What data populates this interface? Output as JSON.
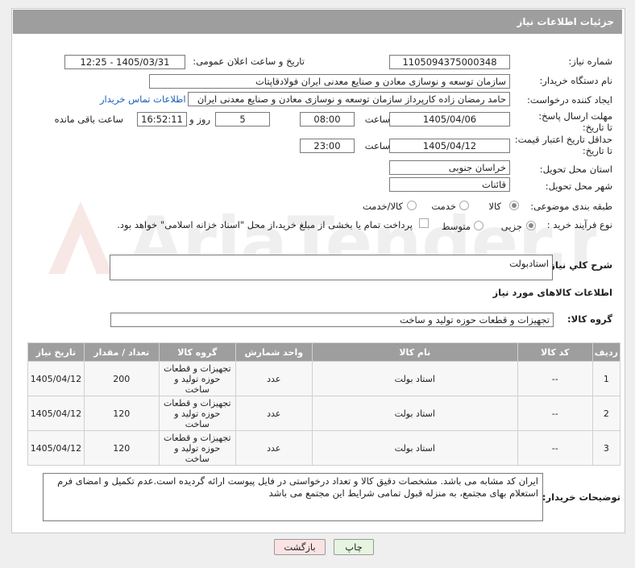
{
  "header": {
    "title": "جزئیات اطلاعات نیاز"
  },
  "need_number": {
    "label": "شماره نیاز:",
    "value": "1105094375000348"
  },
  "announce": {
    "label": "تاریخ و ساعت اعلان عمومی:",
    "value": "1405/03/31 - 12:25"
  },
  "buyer": {
    "label": "نام دستگاه خریدار:",
    "value": "سازمان توسعه و نوسازی معادن و صنایع معدنی ایران فولادقاپتات"
  },
  "requester": {
    "label": "ایجاد کننده درخواست:",
    "value": "حامد  رمضان زاده  کارپرداز  سازمان توسعه و نوسازی معادن و صنایع معدنی ایران",
    "contact_link": "اطلاعات تماس خریدار"
  },
  "reply_deadline": {
    "label": "مهلت ارسال پاسخ: تا تاریخ:",
    "date": "1405/04/06",
    "time_label": "ساعت",
    "time": "08:00",
    "days": "5",
    "days_label": "روز و",
    "remaining": "16:52:11",
    "remaining_label": "ساعت باقی مانده"
  },
  "price_validity": {
    "label": "حداقل تاریخ اعتبار قیمت: تا تاریخ:",
    "date": "1405/04/12",
    "time_label": "ساعت",
    "time": "23:00"
  },
  "province": {
    "label": "استان محل تحویل:",
    "value": "خراسان جنوبی"
  },
  "city": {
    "label": "شهر محل تحویل:",
    "value": "قائنات"
  },
  "category": {
    "label": "طبقه بندی موضوعی:",
    "options": [
      "کالا",
      "خدمت",
      "کالا/خدمت"
    ]
  },
  "process": {
    "label": "نوع فرآیند خرید :",
    "options": [
      "جزیی",
      "متوسط"
    ],
    "payment_text": "پرداخت تمام یا بخشی از مبلغ خرید،از محل \"اسناد خزانه اسلامی\" خواهد بود."
  },
  "description": {
    "label": "شرح کلي نياز:",
    "value": "استادبولت"
  },
  "goods_info": {
    "title": "اطلاعات کالاهای مورد نیاز"
  },
  "goods_group": {
    "label": "گروه کالا:",
    "value": "تجهیزات و قطعات حوزه تولید و ساخت"
  },
  "table": {
    "headers": [
      "ردیف",
      "کد کالا",
      "نام کالا",
      "واحد شمارش",
      "گروه کالا",
      "تعداد / مقدار",
      "تاریخ نیاز"
    ],
    "rows": [
      [
        "1",
        "--",
        "استاد بولت",
        "عدد",
        "تجهیزات و قطعات حوزه تولید و ساخت",
        "200",
        "1405/04/12"
      ],
      [
        "2",
        "--",
        "استاد بولت",
        "عدد",
        "تجهیزات و قطعات حوزه تولید و ساخت",
        "120",
        "1405/04/12"
      ],
      [
        "3",
        "--",
        "استاد بولت",
        "عدد",
        "تجهیزات و قطعات حوزه تولید و ساخت",
        "120",
        "1405/04/12"
      ]
    ]
  },
  "buyer_notes": {
    "label": "توضیحات خریدار:",
    "value": "ایران کد مشابه می باشد. مشخصات دقیق کالا و تعداد درخواستی در فایل پیوست ارائه گردیده است.عدم تکمیل و امضای فرم استعلام بهای مجتمع، به منزله قبول تمامی شرایط این مجتمع می باشد"
  },
  "buttons": {
    "print": "چاپ",
    "back": "بازگشت"
  },
  "watermark": {
    "text": "AriaTender.neT"
  },
  "colors": {
    "header_bg": "#9e9e9e",
    "link": "#1a5fb4",
    "print_btn": "#e6f4e0",
    "back_btn": "#fbe3e3"
  }
}
